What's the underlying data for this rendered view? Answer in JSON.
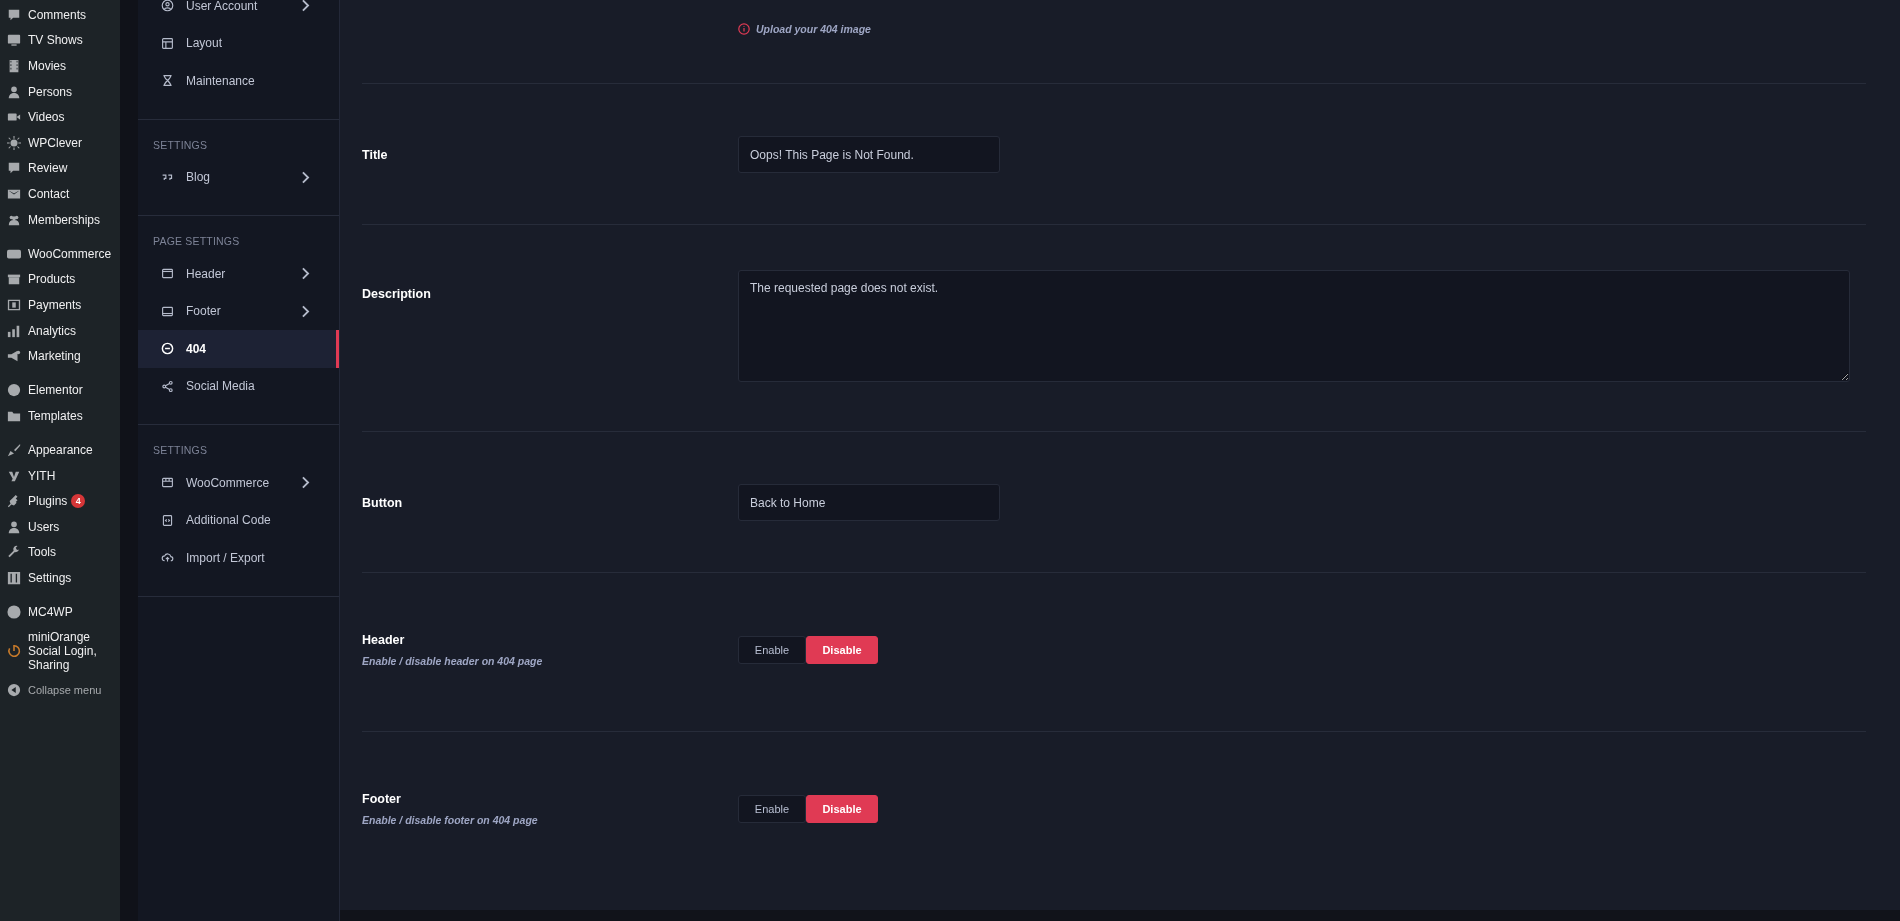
{
  "admin_menu": {
    "groups": [
      [
        {
          "label": "Comments"
        },
        {
          "label": "TV Shows"
        },
        {
          "label": "Movies"
        },
        {
          "label": "Persons"
        },
        {
          "label": "Videos"
        },
        {
          "label": "WPClever"
        },
        {
          "label": "Review"
        },
        {
          "label": "Contact"
        },
        {
          "label": "Memberships"
        }
      ],
      [
        {
          "label": "WooCommerce"
        },
        {
          "label": "Products"
        },
        {
          "label": "Payments"
        },
        {
          "label": "Analytics"
        },
        {
          "label": "Marketing"
        }
      ],
      [
        {
          "label": "Elementor"
        },
        {
          "label": "Templates"
        }
      ],
      [
        {
          "label": "Appearance"
        },
        {
          "label": "YITH"
        },
        {
          "label": "Plugins",
          "badge": "4"
        },
        {
          "label": "Users"
        },
        {
          "label": "Tools"
        },
        {
          "label": "Settings"
        }
      ],
      [
        {
          "label": "MC4WP"
        },
        {
          "label": "miniOrange Social Login, Sharing"
        }
      ]
    ],
    "collapse": "Collapse menu"
  },
  "settings_nav": {
    "sections": [
      {
        "items": [
          {
            "label": "User Account",
            "has_submenu": true,
            "selected": false
          },
          {
            "label": "Layout",
            "has_submenu": false,
            "selected": false
          },
          {
            "label": "Maintenance",
            "has_submenu": false,
            "selected": false
          }
        ]
      },
      {
        "heading": "SETTINGS",
        "items": [
          {
            "label": "Blog",
            "has_submenu": true,
            "selected": false
          }
        ]
      },
      {
        "heading": "PAGE SETTINGS",
        "items": [
          {
            "label": "Header",
            "has_submenu": true,
            "selected": false
          },
          {
            "label": "Footer",
            "has_submenu": true,
            "selected": false
          },
          {
            "label": "404",
            "has_submenu": false,
            "selected": true
          },
          {
            "label": "Social Media",
            "has_submenu": false,
            "selected": false
          }
        ]
      },
      {
        "heading": "SETTINGS",
        "items": [
          {
            "label": "WooCommerce",
            "has_submenu": true,
            "selected": false
          },
          {
            "label": "Additional Code",
            "has_submenu": false,
            "selected": false
          },
          {
            "label": "Import / Export",
            "has_submenu": false,
            "selected": false
          }
        ]
      }
    ]
  },
  "panel": {
    "upload_hint": "Upload your 404 image",
    "fields": [
      {
        "kind": "text",
        "label": "Title",
        "value": "Oops! This Page is Not Found."
      },
      {
        "kind": "textarea",
        "label": "Description",
        "value": "The requested page does not exist."
      },
      {
        "kind": "text",
        "label": "Button",
        "value": "Back to Home"
      },
      {
        "kind": "toggle",
        "label": "Header",
        "description": "Enable / disable header on 404 page",
        "options": [
          {
            "label": "Enable",
            "selected": false
          },
          {
            "label": "Disable",
            "selected": true
          }
        ]
      },
      {
        "kind": "toggle",
        "label": "Footer",
        "description": "Enable / disable footer on 404 page",
        "options": [
          {
            "label": "Enable",
            "selected": false
          },
          {
            "label": "Disable",
            "selected": true
          }
        ]
      }
    ]
  }
}
